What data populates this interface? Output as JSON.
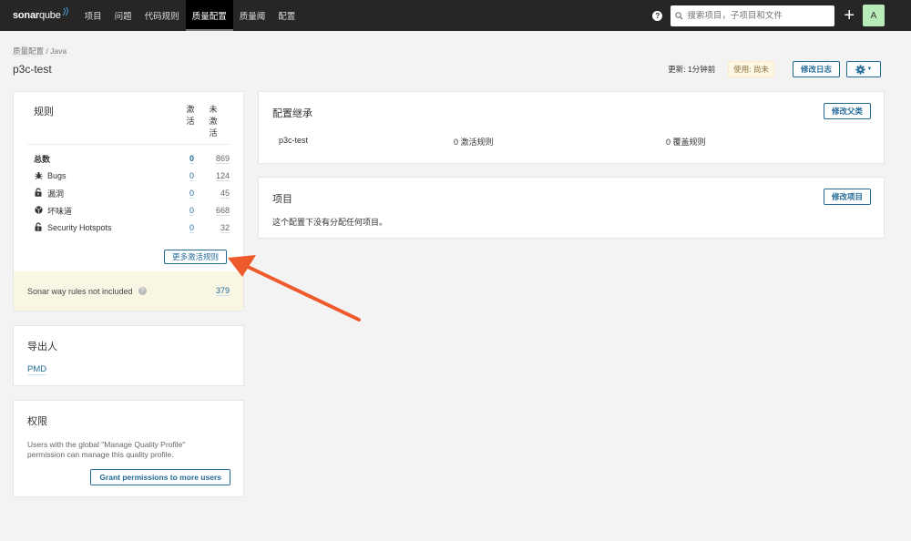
{
  "navbar": {
    "logo_bold": "sonar",
    "logo_light": "qube",
    "items": [
      {
        "label": "项目",
        "active": false
      },
      {
        "label": "问题",
        "active": false
      },
      {
        "label": "代码规则",
        "active": false
      },
      {
        "label": "质量配置",
        "active": true
      },
      {
        "label": "质量阈",
        "active": false
      },
      {
        "label": "配置",
        "active": false
      }
    ],
    "help_icon": "?",
    "search_placeholder": "搜索项目，子项目和文件",
    "add_icon": "+",
    "avatar_letter": "A"
  },
  "header": {
    "breadcrumb_parent": "质量配置",
    "breadcrumb_sep": " / ",
    "breadcrumb_lang": "Java",
    "title": "p3c-test",
    "updated": "更新: 1分钟前",
    "used": "使用: 尚未",
    "changelog_button": "修改日志",
    "gear_caret": "▼"
  },
  "rules": {
    "title": "规则",
    "col_active": "激活",
    "col_inactive": "未激活",
    "rows": [
      {
        "label": "总数",
        "icon": "",
        "active": "0",
        "inactive": "869"
      },
      {
        "label": "Bugs",
        "icon": "bug-icon",
        "active": "0",
        "inactive": "124"
      },
      {
        "label": "漏洞",
        "icon": "lock-icon",
        "active": "0",
        "inactive": "45"
      },
      {
        "label": "坏味道",
        "icon": "code-smell-icon",
        "active": "0",
        "inactive": "668"
      },
      {
        "label": "Security Hotspots",
        "icon": "security-hotspot-icon",
        "active": "0",
        "inactive": "32"
      }
    ],
    "more_button": "更多激活规则",
    "sonar_way_label": "Sonar way rules not included",
    "sonar_way_count": "379"
  },
  "exporters": {
    "title": "导出人",
    "items": [
      "PMD"
    ]
  },
  "permissions": {
    "title": "权限",
    "text": "Users with the global \"Manage Quality Profile\" permission can manage this quality profile.",
    "grant_button": "Grant permissions to more users"
  },
  "inheritance": {
    "title": "配置继承",
    "change_parent_button": "修改父类",
    "profile_name": "p3c-test",
    "active_rules": "0 激活规则",
    "overridden_rules": "0 覆盖规则"
  },
  "projects": {
    "title": "项目",
    "change_button": "修改项目",
    "empty_text": "这个配置下没有分配任何项目。"
  },
  "colors": {
    "navbar": "#262626",
    "accent": "#236a97",
    "avatar": "#b7ebb7",
    "annotation_arrow": "#ee5a2b"
  }
}
